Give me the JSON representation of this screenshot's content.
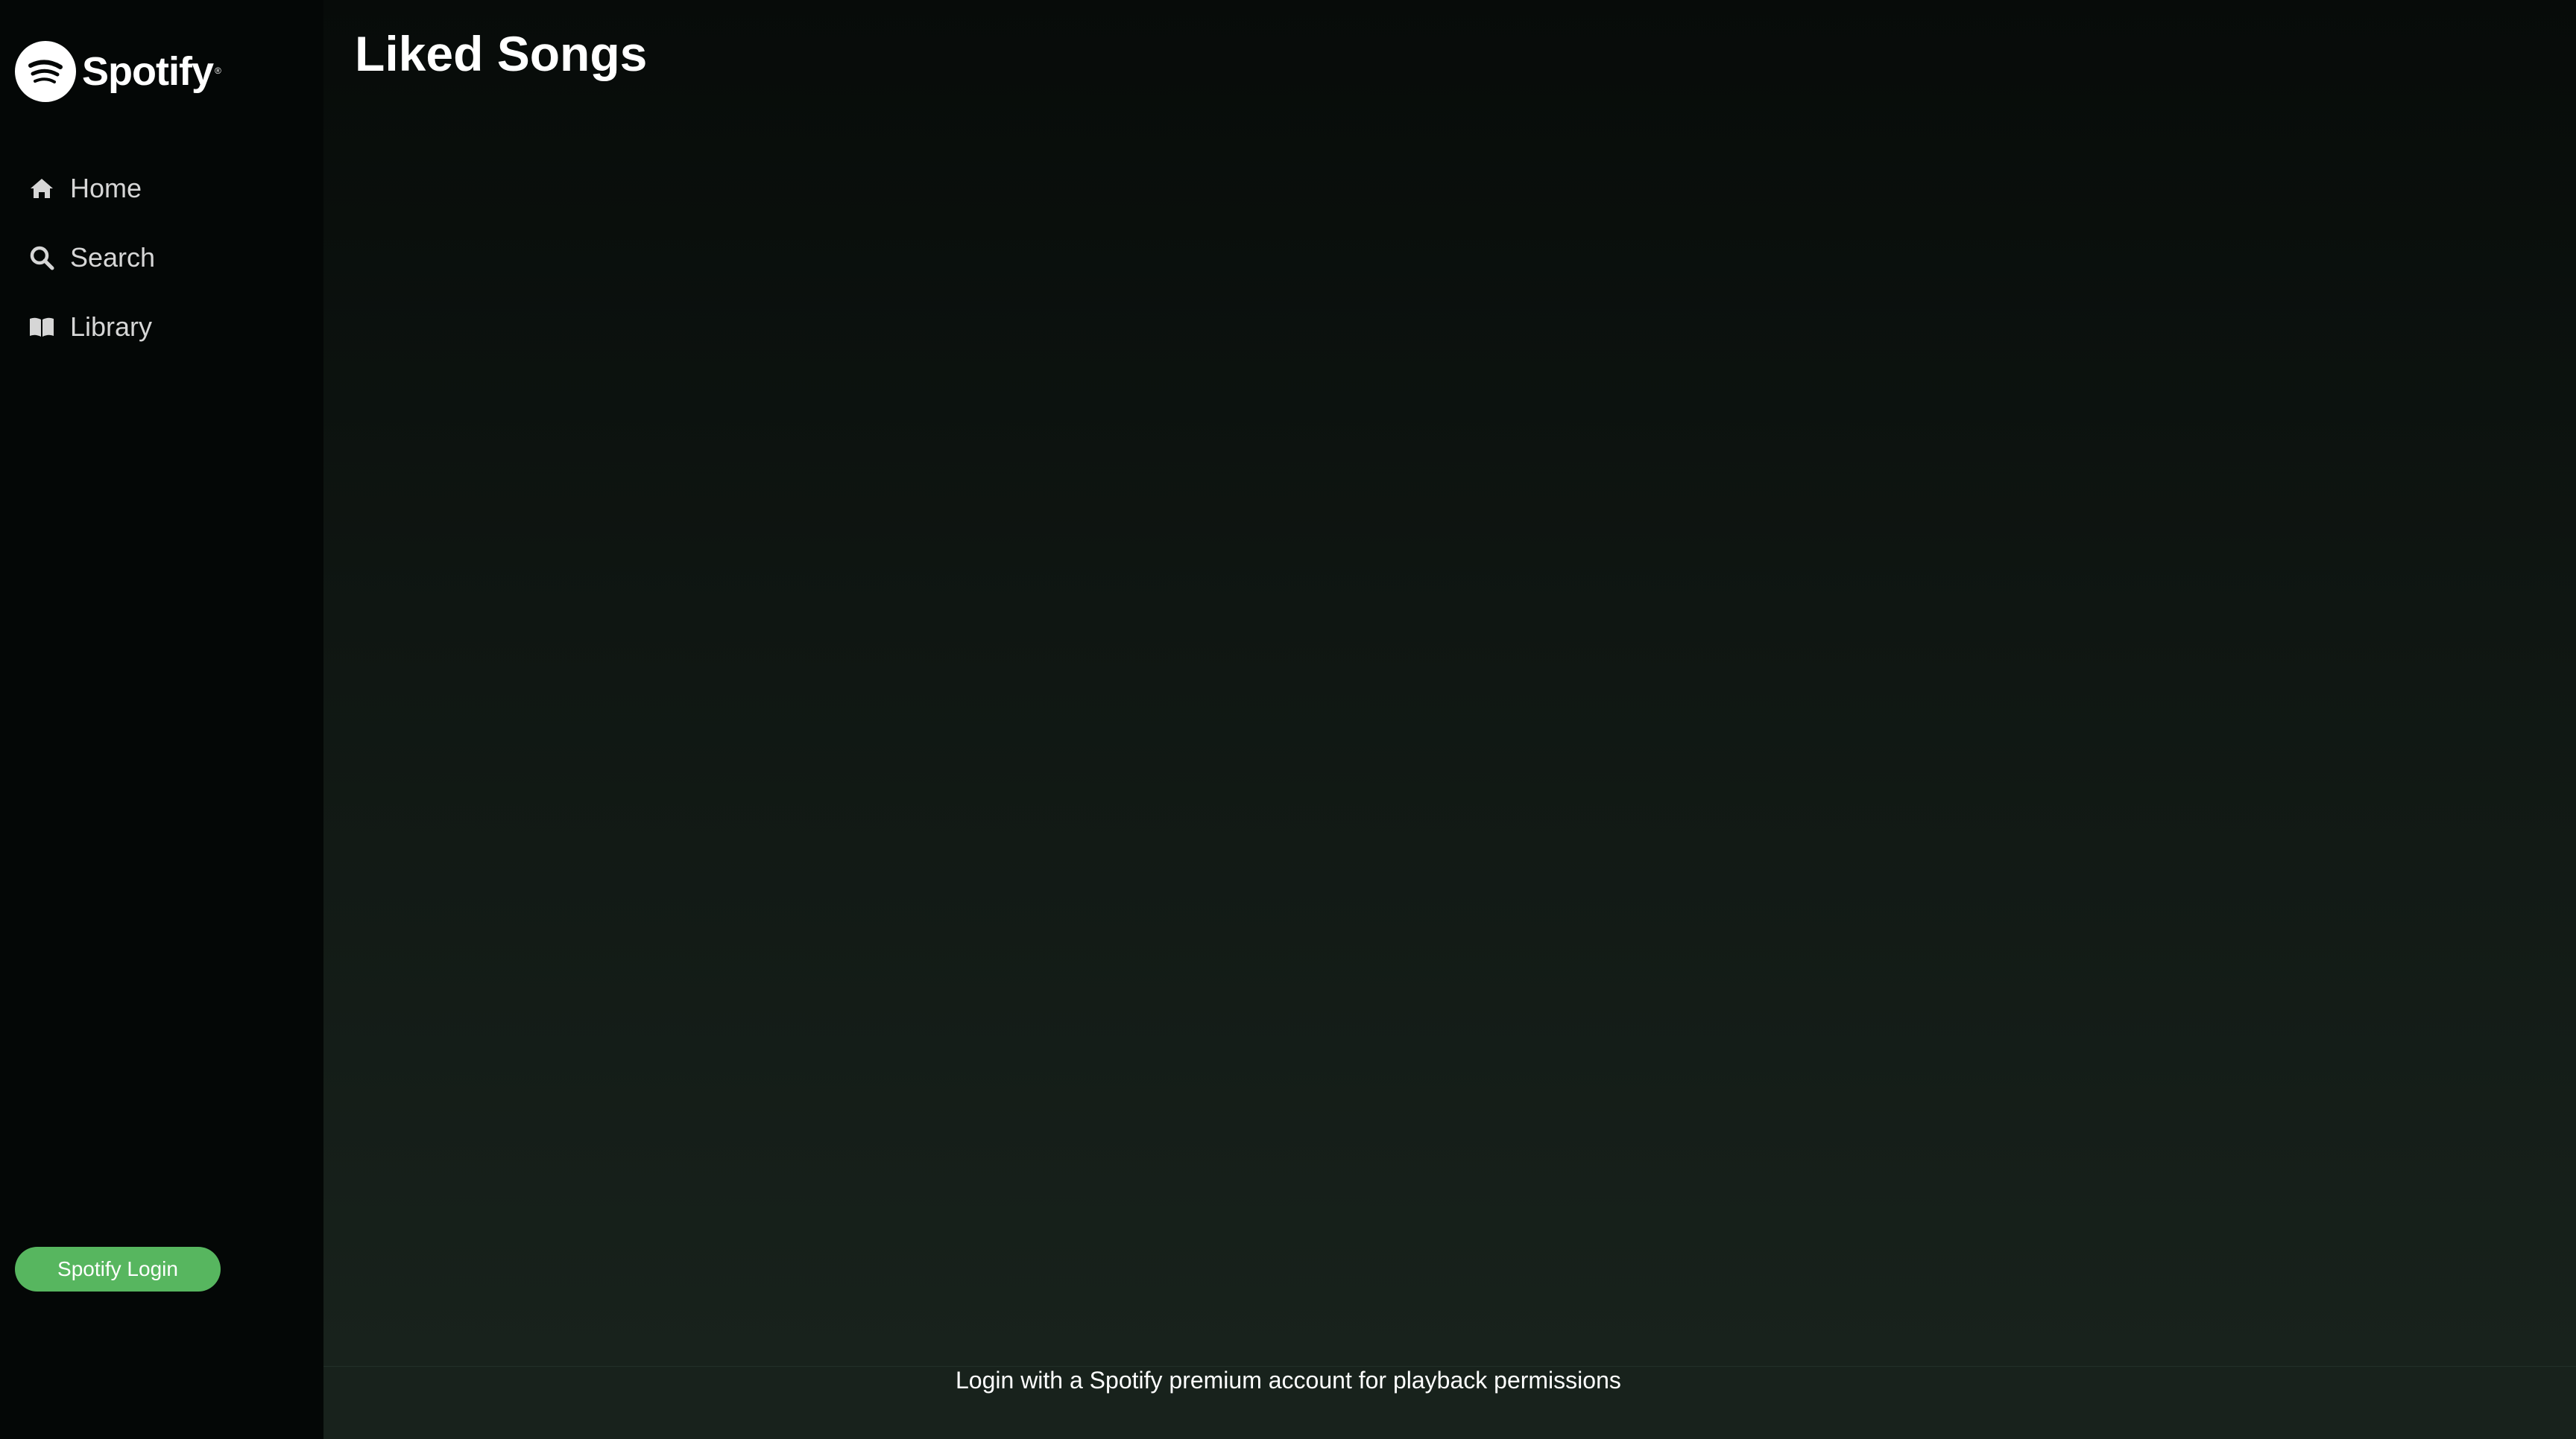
{
  "app": {
    "brand": "Spotify"
  },
  "sidebar": {
    "items": [
      {
        "label": "Home",
        "icon": "home-icon"
      },
      {
        "label": "Search",
        "icon": "search-icon"
      },
      {
        "label": "Library",
        "icon": "library-icon"
      }
    ],
    "login_button": "Spotify Login"
  },
  "main": {
    "title": "Liked Songs"
  },
  "footer": {
    "message": "Login with a Spotify premium account for playback permissions"
  },
  "colors": {
    "accent": "#57b65f",
    "sidebar_bg": "#040706",
    "text": "#ffffff"
  }
}
